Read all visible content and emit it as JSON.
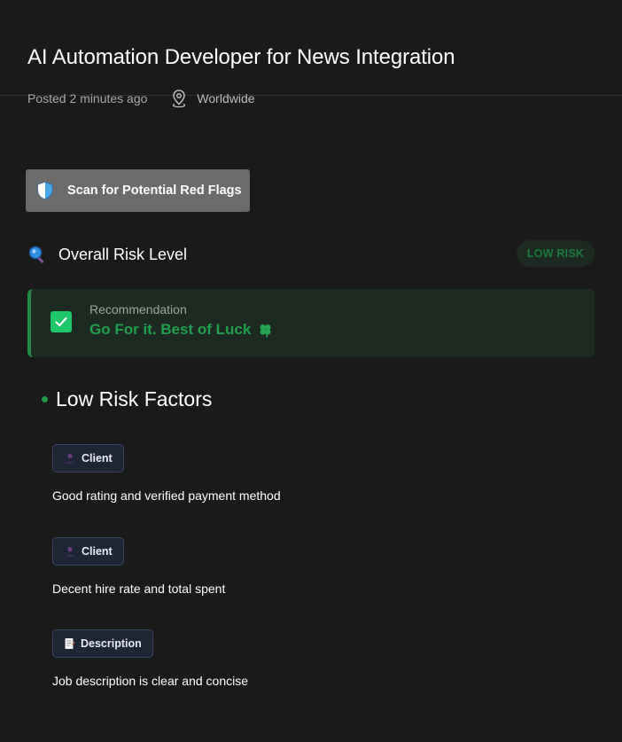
{
  "job": {
    "title": "AI Automation Developer for News Integration",
    "posted": "Posted 2 minutes ago",
    "location": "Worldwide",
    "location_icon": "map-pin-icon"
  },
  "scan": {
    "button_label": "Scan for Potential Red Flags",
    "icon": "shield-icon"
  },
  "risk": {
    "label": "Overall Risk Level",
    "icon": "magnifier-icon",
    "badge": "LOW RISK",
    "badge_color": "#1b7a3d"
  },
  "recommendation": {
    "label": "Recommendation",
    "value": "Go For it. Best of Luck",
    "accent": "#229e4e"
  },
  "factors": {
    "title": "Low Risk Factors",
    "items": [
      {
        "tag": "Client",
        "icon": "person-icon",
        "description": "Good rating and verified payment method"
      },
      {
        "tag": "Client",
        "icon": "person-icon",
        "description": "Decent hire rate and total spent"
      },
      {
        "tag": "Description",
        "icon": "memo-icon",
        "description": "Job description is clear and concise"
      }
    ]
  }
}
